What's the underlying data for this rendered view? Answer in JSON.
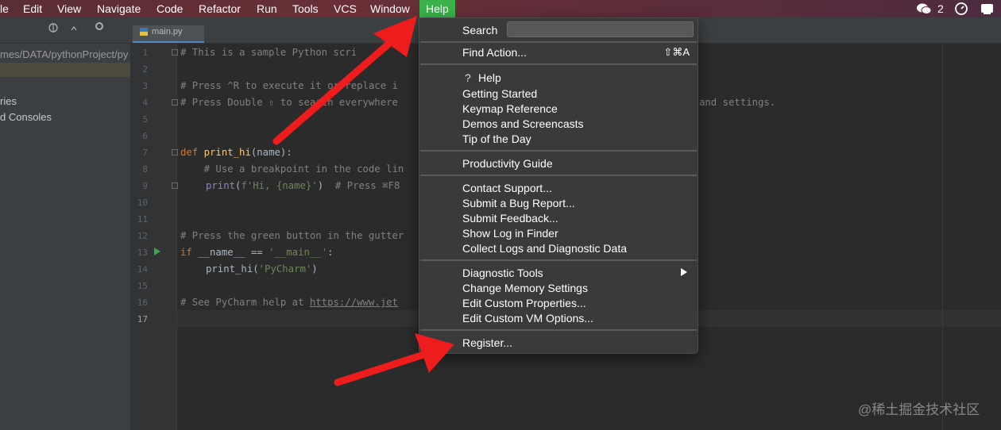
{
  "menubar": {
    "items": [
      "le",
      "Edit",
      "View",
      "Navigate",
      "Code",
      "Refactor",
      "Run",
      "Tools",
      "VCS",
      "Window"
    ],
    "help": "Help",
    "wechat_badge": "2",
    "accent": "#3bb14a"
  },
  "editor_tab": {
    "label": "main.py"
  },
  "sidebar": {
    "path": "mes/DATA/pythonProject/py",
    "items": [
      "ries",
      "d Consoles"
    ]
  },
  "editor": {
    "line_numbers": [
      "1",
      "2",
      "3",
      "4",
      "5",
      "6",
      "7",
      "8",
      "9",
      "10",
      "11",
      "12",
      "13",
      "14",
      "15",
      "16",
      "17"
    ],
    "current_line": "17",
    "lines": {
      "l1": "# This is a sample Python scri",
      "l3": "# Press ^R to execute it or replace i",
      "l4": "# Press Double ⇧ to search everywhere",
      "l4_tail": "and settings.",
      "l7_def": "def ",
      "l7_fn": "print_hi",
      "l7_rest": "(name):",
      "l8": "    # Use a breakpoint in the code lin",
      "l9_print": "print",
      "l9_rest_a": "(",
      "l9_str": "f'Hi, {name}'",
      "l9_rest_b": ")  ",
      "l9_cmt": "# Press ⌘F8",
      "l12": "# Press the green button in the gutter",
      "l13_if": "if ",
      "l13_rest": "__name__ == ",
      "l13_str": "'__main__'",
      "l13_colon": ":",
      "l14_fn": "print_hi",
      "l14_a": "(",
      "l14_str": "'PyCharm'",
      "l14_b": ")",
      "l16_cmt": "# See PyCharm help at ",
      "l16_link": "https://www.jet"
    }
  },
  "help_menu": {
    "search_label": "Search",
    "find_action": "Find Action...",
    "find_action_shortcut": "⇧⌘A",
    "help_q": "?",
    "group1": [
      "Help",
      "Getting Started",
      "Keymap Reference",
      "Demos and Screencasts",
      "Tip of the Day"
    ],
    "group2": [
      "Productivity Guide"
    ],
    "group3": [
      "Contact Support...",
      "Submit a Bug Report...",
      "Submit Feedback...",
      "Show Log in Finder",
      "Collect Logs and Diagnostic Data"
    ],
    "group4": [
      "Diagnostic Tools",
      "Change Memory Settings",
      "Edit Custom Properties...",
      "Edit Custom VM Options..."
    ],
    "group5": [
      "Register..."
    ]
  },
  "watermark": "@稀土掘金技术社区",
  "colors": {
    "arrow": "#ee1c1c",
    "menu_bg": "#3a3a3a",
    "editor_bg": "#2b2b2b"
  }
}
